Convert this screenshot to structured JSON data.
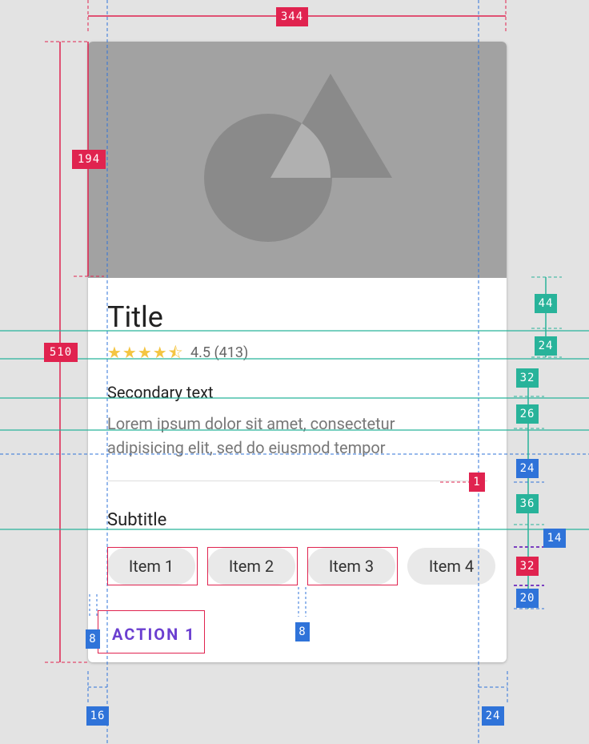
{
  "card": {
    "title": "Title",
    "rating_stars": "★★★★⯪",
    "rating_text": "4.5 (413)",
    "secondary_text": "Secondary text",
    "body_text": "Lorem ipsum dolor sit amet, consectetur adipisicing elit, sed do eiusmod tempor",
    "subtitle": "Subtitle",
    "chips": [
      "Item 1",
      "Item 2",
      "Item 3",
      "Item 4"
    ],
    "action": "ACTION 1"
  },
  "measurements": {
    "card_width": "344",
    "media_height": "194",
    "card_height": "510",
    "title_spacing": "44",
    "rating_spacing": "24",
    "secondary_spacing": "32",
    "body_spacing": "26",
    "divider_spacing": "24",
    "subtitle_spacing": "36",
    "chip_gap_top": "14",
    "chip_height": "32",
    "chip_bottom": "20",
    "divider_thickness": "1",
    "chip_spacing": "8",
    "action_padding": "8",
    "left_padding": "16",
    "right_padding": "24"
  },
  "colors": {
    "background": "#e3e3e3",
    "card": "#ffffff",
    "media": "#a2a2a2",
    "media_shapes": "#8a8a8a",
    "accent": "#6b3fd0",
    "red_measure": "#e0234f",
    "teal_measure": "#28b39a",
    "blue_measure": "#2f73d9",
    "star": "#f4c542"
  }
}
